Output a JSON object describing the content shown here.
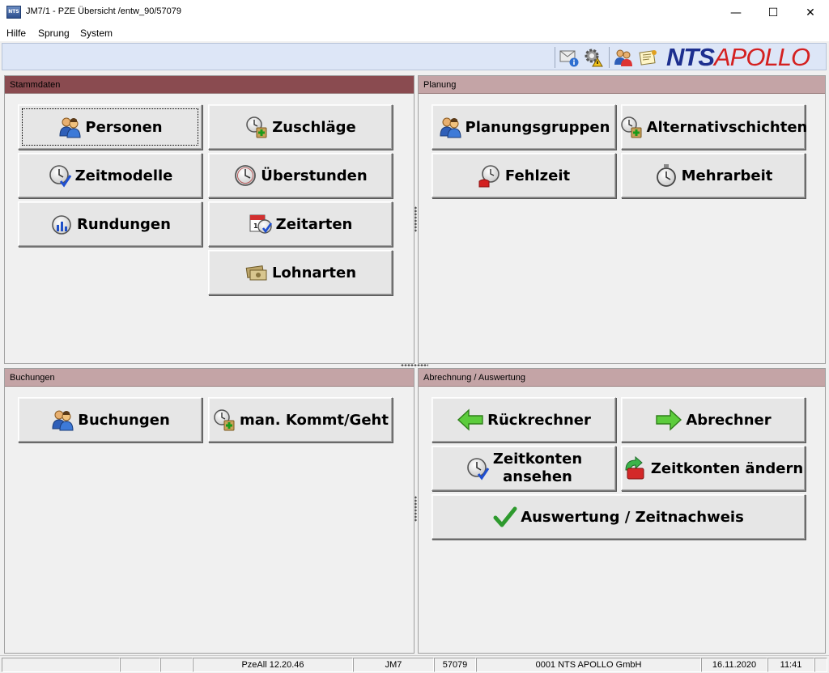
{
  "window": {
    "title": "JM7/1 - PZE Übersicht /entw_90/57079",
    "app_icon_text": "NTS",
    "minimize_glyph": "—",
    "maximize_glyph": "☐",
    "close_glyph": "✕"
  },
  "menu": {
    "items": [
      "Hilfe",
      "Sprung",
      "System"
    ]
  },
  "toolbar": {
    "icons": [
      "mail-info-icon",
      "settings-warning-icon",
      "users-icon",
      "notes-icon"
    ],
    "brand_nts": "NTS",
    "brand_apollo": "APOLLO"
  },
  "panels": {
    "stammdaten": {
      "title": "Stammdaten",
      "buttons": [
        "Personen",
        "Zuschläge",
        "Zeitmodelle",
        "Überstunden",
        "Rundungen",
        "Zeitarten",
        "Lohnarten"
      ]
    },
    "planung": {
      "title": "Planung",
      "buttons": [
        "Planungsgruppen",
        "Alternativschichten",
        "Fehlzeit",
        "Mehrarbeit"
      ]
    },
    "buchungen": {
      "title": "Buchungen",
      "buttons": [
        "Buchungen",
        "man. Kommt/Geht"
      ]
    },
    "abrechnung": {
      "title": "Abrechnung / Auswertung",
      "buttons": [
        "Rückrechner",
        "Abrechner",
        "Zeitkonten\nansehen",
        "Zeitkonten ändern",
        "Auswertung / Zeitnachweis"
      ]
    }
  },
  "statusbar": {
    "cells": [
      "",
      "",
      "",
      "PzeAll 12.20.46",
      "JM7",
      "57079",
      "0001 NTS APOLLO GmbH",
      "16.11.2020",
      "11:41",
      ""
    ]
  },
  "colors": {
    "header_active": "#8a4b50",
    "header_inactive": "#c4a4a6",
    "toolbar_bg": "#dde6f7",
    "brand_blue": "#1d2f8f",
    "brand_red": "#d42020"
  }
}
